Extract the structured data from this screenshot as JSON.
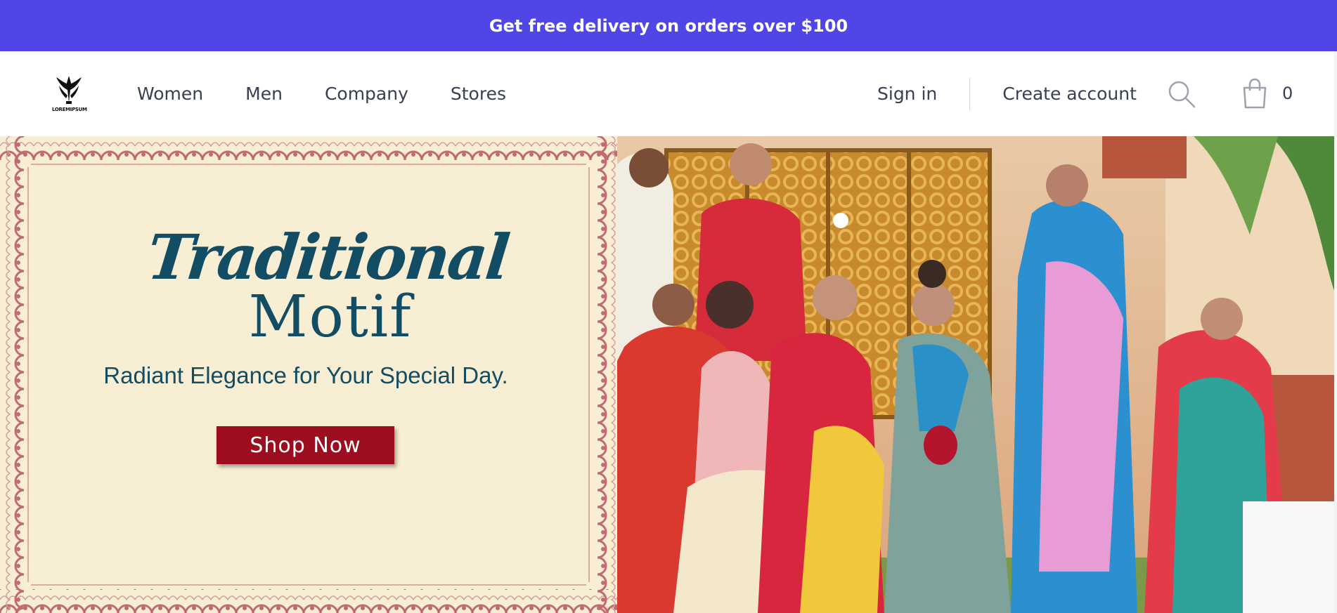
{
  "colors": {
    "promo_bg": "#4f46e5",
    "hero_panel_bg": "#f7eed4",
    "hero_heading": "#134d63",
    "cta_bg": "#9b0d1f",
    "border_pattern": "#c06a72"
  },
  "promo": {
    "text": "Get free delivery on orders over $100"
  },
  "header": {
    "logo_text": "LOREMIPSUM",
    "nav": [
      "Women",
      "Men",
      "Company",
      "Stores"
    ],
    "sign_in": "Sign in",
    "create_account": "Create account",
    "search_icon": "search-icon",
    "cart_icon": "shopping-bag-icon",
    "cart_count": "0"
  },
  "hero": {
    "title_line1": "Traditional",
    "title_line2": "Motif",
    "tagline": "Radiant Elegance for Your Special Day.",
    "cta_label": "Shop Now"
  }
}
